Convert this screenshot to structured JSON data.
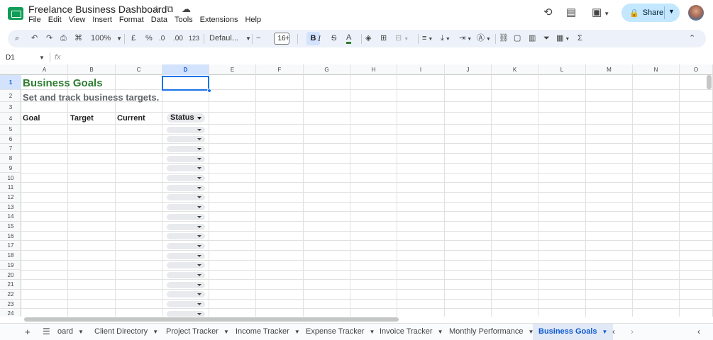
{
  "app": {
    "doc_title": "Freelance Business Dashboard",
    "menu": [
      "File",
      "Edit",
      "View",
      "Insert",
      "Format",
      "Data",
      "Tools",
      "Extensions",
      "Help"
    ],
    "share_label": "Share",
    "icons": {
      "star": "star-icon",
      "move": "move-to-folder-icon",
      "cloud": "cloud-status-icon",
      "history": "history-icon",
      "comments": "comments-icon",
      "meet": "meet-icon",
      "lock": "lock-icon"
    }
  },
  "toolbar": {
    "zoom": "100%",
    "currency": "£",
    "percent": "%",
    "decimal_decrease": ".0",
    "decimal_increase": ".00",
    "number_format": "123",
    "font": "Defaul...",
    "font_size": "16",
    "minus": "−",
    "plus": "+",
    "bold": "B",
    "italic": "I",
    "strike": "S",
    "text_color": "A"
  },
  "formula_bar": {
    "name_box": "D1",
    "fx": "fx",
    "value": ""
  },
  "grid": {
    "columns": [
      "A",
      "B",
      "C",
      "D",
      "E",
      "F",
      "G",
      "H",
      "I",
      "J",
      "K",
      "L",
      "M",
      "N",
      "O"
    ],
    "selected_column": "D",
    "rows": [
      "1",
      "2",
      "3",
      "4",
      "5",
      "6",
      "7",
      "8",
      "9",
      "10",
      "11",
      "12",
      "13",
      "14",
      "15",
      "16",
      "17",
      "18",
      "19",
      "20",
      "21",
      "22",
      "23",
      "24"
    ],
    "selected_row": "1",
    "cells": {
      "A1": "Business Goals",
      "A2": "Set and track business targets.",
      "A4": "Goal",
      "B4": "Target",
      "C4": "Current",
      "D4": "Status"
    },
    "title_color": "#2e7d32",
    "subtitle_color": "#5f6368",
    "dropdown_rows": 20
  },
  "sheets": {
    "tabs": [
      "oard",
      "Client Directory",
      "Project Tracker",
      "Income Tracker",
      "Expense Tracker",
      "Invoice Tracker",
      "Monthly Performance",
      "Business Goals"
    ],
    "active": "Business Goals"
  }
}
